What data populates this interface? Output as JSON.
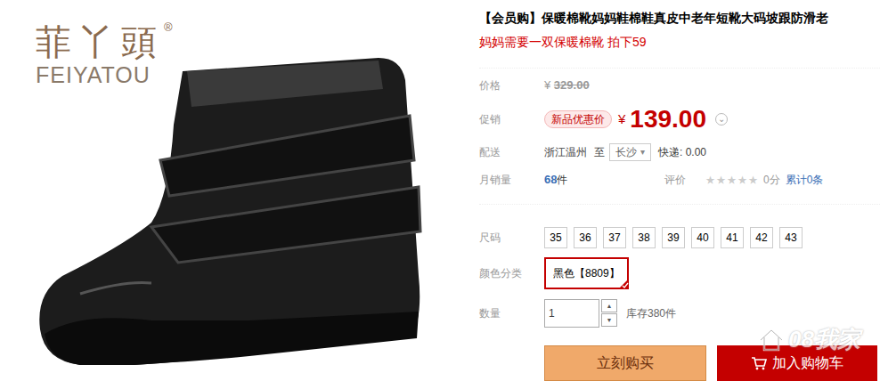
{
  "logo": {
    "name": "菲丫頭",
    "registered": "®",
    "latin": "FEIYATOU"
  },
  "product": {
    "title": "【会员购】保暖棉靴妈妈鞋棉鞋真皮中老年短靴大码坡跟防滑老",
    "promo": "妈妈需要一双保暖棉靴 拍下59"
  },
  "price": {
    "label": "价格",
    "currency": "¥",
    "value": "329.00"
  },
  "promotion": {
    "label": "促销",
    "tag": "新品优惠价",
    "currency": "¥",
    "value": "139.00",
    "toggle": "⌄"
  },
  "delivery": {
    "label": "配送",
    "from": "浙江温州",
    "to_word": "至",
    "city": "长沙",
    "dropdown": "▾",
    "shipping": "快递: 0.00"
  },
  "sales": {
    "label": "月销量",
    "count": "68",
    "unit": "件"
  },
  "rating": {
    "label": "评价",
    "stars": 0,
    "score": "0分",
    "total": "累计0条"
  },
  "sizes": {
    "label": "尺码",
    "options": [
      {
        "label": "35",
        "selected": false
      },
      {
        "label": "36",
        "selected": false
      },
      {
        "label": "37",
        "selected": false
      },
      {
        "label": "38",
        "selected": false
      },
      {
        "label": "39",
        "selected": false
      },
      {
        "label": "40",
        "selected": false
      },
      {
        "label": "41",
        "selected": false
      },
      {
        "label": "42",
        "selected": false
      },
      {
        "label": "43",
        "selected": false
      }
    ]
  },
  "colors": {
    "label": "颜色分类",
    "options": [
      {
        "label": "黑色【8809】",
        "selected": true
      }
    ]
  },
  "quantity": {
    "label": "数量",
    "value": "1",
    "up": "▲",
    "down": "▼",
    "stock": "库存380件"
  },
  "buttons": [
    {
      "label": "立刻购买",
      "kind": "buy"
    },
    {
      "label": "加入购物车",
      "kind": "cart"
    }
  ],
  "watermark": {
    "text": "08我家"
  }
}
